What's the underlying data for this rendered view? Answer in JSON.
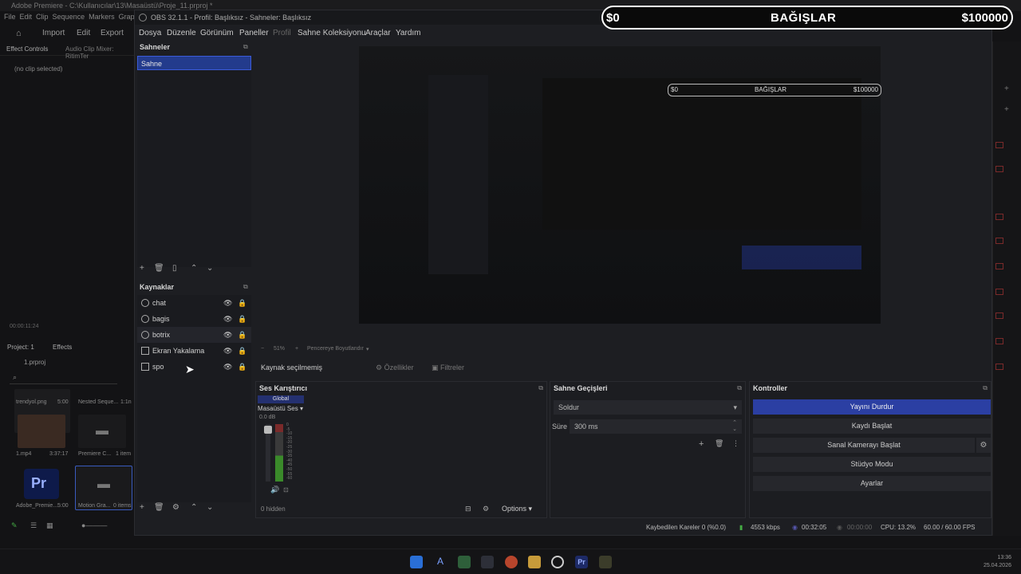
{
  "premiere": {
    "title": "Adobe Premiere - C:\\Kullanıcılar\\13\\Masaüstü\\Proje_11.prproj *",
    "menu": [
      "File",
      "Edit",
      "Clip",
      "Sequence",
      "Markers",
      "Grap"
    ],
    "nav": {
      "import": "Import",
      "edit": "Edit",
      "export": "Export"
    },
    "effect_tabs": {
      "effect_controls": "Effect Controls",
      "audio_mixer": "Audio Clip Mixer: RitimTer"
    },
    "no_clip": "(no clip selected)",
    "timecode": "00:00:11:24",
    "project_tabs": {
      "project": "Project: 1",
      "effects": "Effects"
    },
    "project_name": "1.prproj",
    "items": [
      {
        "name": "trendyol.png",
        "duration": "5:00"
      },
      {
        "name": "Nested Seque...",
        "duration": "1:1n"
      },
      {
        "name": "1.mp4",
        "duration": "3:37:17"
      },
      {
        "name": "Premiere C...",
        "duration": "1 item"
      },
      {
        "name": "Adobe_Premie...",
        "duration": "5:00"
      },
      {
        "name": "Motion Gra...",
        "duration": "0 items"
      }
    ]
  },
  "obs": {
    "title": "OBS 32.1.1 - Profil: Başlıksız - Sahneler: Başlıksız",
    "menu": [
      "Dosya",
      "Düzenle",
      "Görünüm",
      "Paneller",
      "Profil",
      "Sahne Koleksiyonu",
      "Araçlar",
      "Yardım"
    ],
    "scenes": {
      "title": "Sahneler",
      "items": [
        "Sahne"
      ]
    },
    "sources": {
      "title": "Kaynaklar",
      "items": [
        {
          "name": "chat",
          "icon": "globe-icon"
        },
        {
          "name": "bagis",
          "icon": "globe-icon"
        },
        {
          "name": "botrix",
          "icon": "globe-icon"
        },
        {
          "name": "Ekran Yakalama",
          "icon": "monitor-icon"
        },
        {
          "name": "spo",
          "icon": "monitor-icon"
        }
      ]
    },
    "preview": {
      "zoom": "51%",
      "fit": "Pencereye Boyutlandır"
    },
    "source_toolbar": {
      "no_source": "Kaynak seçilmemiş",
      "properties": "Özellikler",
      "filters": "Filtreler"
    },
    "mixer": {
      "title": "Ses Karıştırıcı",
      "global": "Global",
      "channel": "Masaüstü Ses",
      "db": "0.0 dB",
      "scale": [
        "0",
        "-5",
        "-10",
        "-15",
        "-20",
        "-25",
        "-30",
        "-35",
        "-40",
        "-45",
        "-50",
        "-55",
        "-60"
      ],
      "hidden": "0 hidden",
      "options": "Options"
    },
    "transitions": {
      "title": "Sahne Geçişleri",
      "type": "Soldur",
      "duration_label": "Süre",
      "duration": "300 ms"
    },
    "controls": {
      "title": "Kontroller",
      "stop_stream": "Yayını Durdur",
      "start_record": "Kaydı Başlat",
      "virtual_cam": "Sanal Kamerayı Başlat",
      "studio_mode": "Stüdyo Modu",
      "settings": "Ayarlar"
    },
    "status": {
      "dropped": "Kaybedilen Kareler 0 (%0.0)",
      "bitrate": "4553 kbps",
      "stream_time": "00:32:05",
      "rec_time": "00:00:00",
      "cpu": "CPU: 13.2%",
      "fps": "60.00 / 60.00 FPS"
    }
  },
  "donation": {
    "min": "$0",
    "title": "BAĞIŞLAR",
    "max": "$100000",
    "progress": 0.0
  },
  "taskbar": {
    "time": "13:36",
    "date": "25.04.2026"
  },
  "colors": {
    "accent": "#2b3fa3",
    "scene_selected": "#233b8c",
    "meter_green": "#3a8a2a"
  }
}
